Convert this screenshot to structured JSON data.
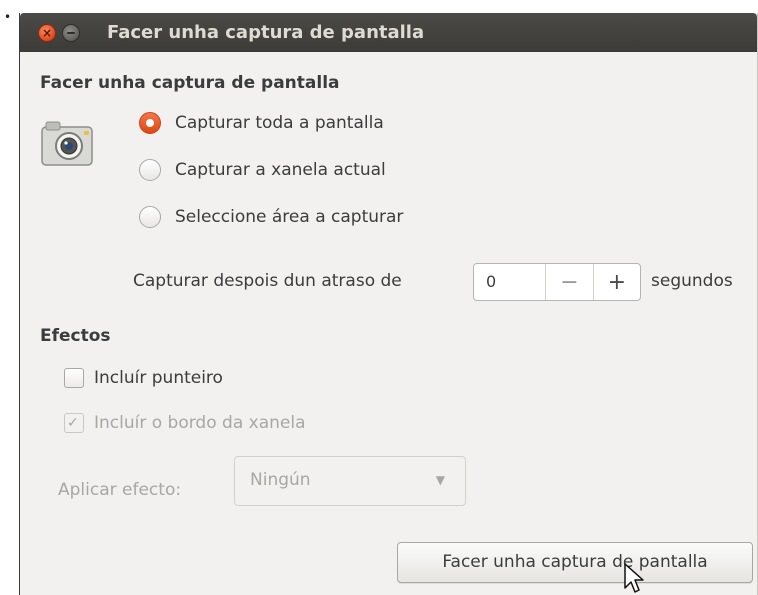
{
  "page": {
    "bullet": "•"
  },
  "window": {
    "title": "Facer unha captura de pantalla",
    "close_glyph": "×"
  },
  "capture_section": {
    "heading": "Facer unha captura de pantalla",
    "options": [
      {
        "label": "Capturar toda a pantalla",
        "selected": true
      },
      {
        "label": "Capturar a xanela actual",
        "selected": false
      },
      {
        "label": "Seleccione área a capturar",
        "selected": false
      }
    ],
    "delay": {
      "label": "Capturar despois dun atraso de",
      "value": "0",
      "minus": "−",
      "plus": "+",
      "unit": "segundos"
    }
  },
  "effects": {
    "heading": "Efectos",
    "include_pointer": {
      "label": "Incluír punteiro",
      "checked": false
    },
    "include_border": {
      "label": "Incluír o bordo da xanela",
      "checked": true,
      "disabled": true,
      "mark": "✓"
    },
    "apply_effect": {
      "label": "Aplicar efecto:",
      "value": "Ningún",
      "arrow": "▼"
    }
  },
  "actions": {
    "capture_button": "Facer unha captura de pantalla"
  },
  "colors": {
    "titlebar": "#3c3b37",
    "window_bg": "#f2f1f0",
    "accent_orange": "#dd4814",
    "disabled_text": "#a8a7a3"
  },
  "icons": {
    "window": "camera-icon",
    "cursor": "mouse-pointer-icon"
  }
}
